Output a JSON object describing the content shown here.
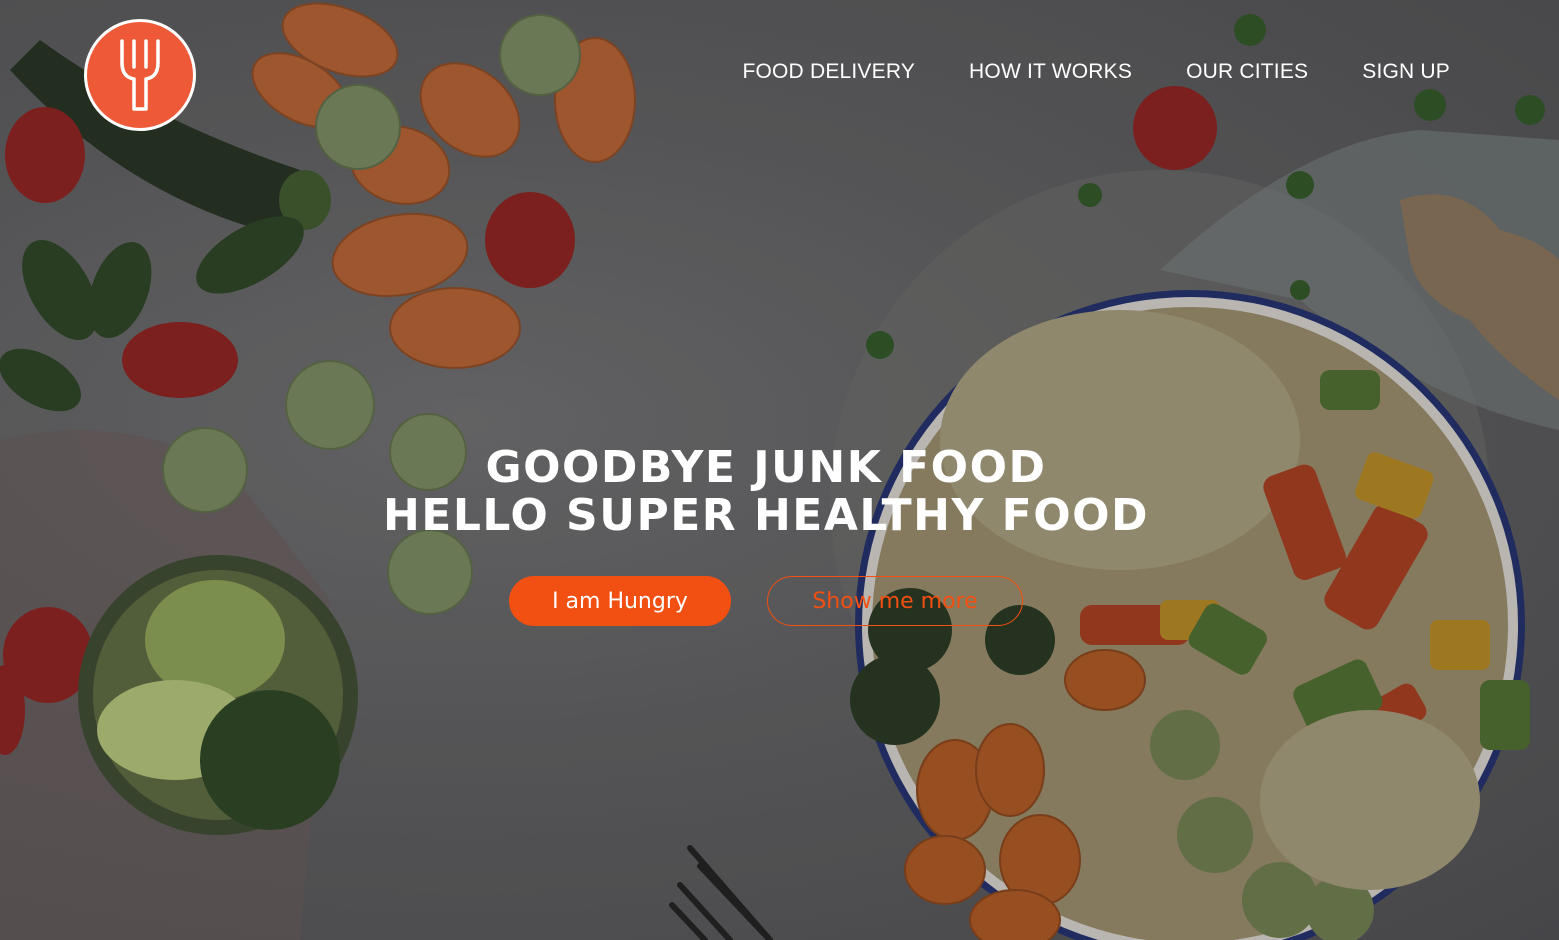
{
  "brand": {
    "logo_icon": "fork-icon",
    "accent_color": "#ee5a38"
  },
  "nav": {
    "items": [
      {
        "label": "FOOD DELIVERY"
      },
      {
        "label": "HOW IT WORKS"
      },
      {
        "label": "OUR CITIES"
      },
      {
        "label": "SIGN UP"
      }
    ]
  },
  "hero": {
    "headline_line1": "GOODBYE JUNK FOOD",
    "headline_line2": "HELLO SUPER HEALTHY FOOD",
    "primary_button": "I am Hungry",
    "secondary_button": "Show me more",
    "button_color": "#f24f12"
  }
}
